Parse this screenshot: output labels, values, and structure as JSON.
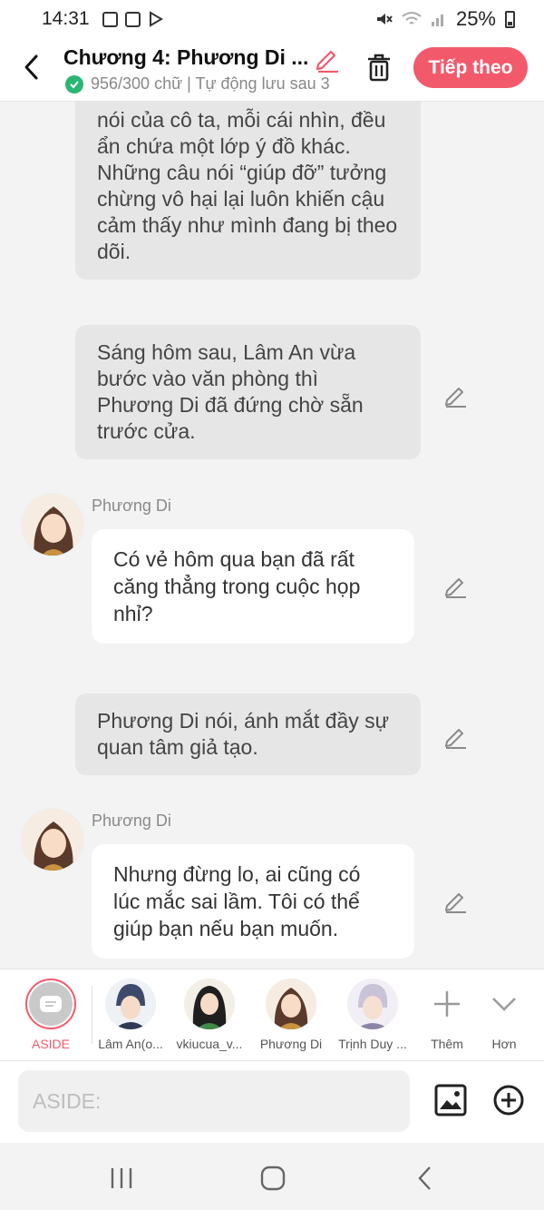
{
  "status_bar": {
    "time": "14:31",
    "battery": "25%"
  },
  "header": {
    "title": "Chương 4: Phương Di ...",
    "subtitle": "956/300 chữ | Tự động lưu sau 3",
    "next_label": "Tiếp theo"
  },
  "messages": [
    {
      "type": "narration",
      "text": "nói của cô ta, mỗi cái nhìn, đều ẩn chứa một lớp ý đồ khác. Những câu nói “giúp đỡ” tưởng chừng vô hại lại luôn khiến cậu cảm thấy như mình đang bị theo dõi."
    },
    {
      "type": "narration",
      "text": "Sáng hôm sau, Lâm An vừa bước vào văn phòng thì Phương Di đã đứng chờ sẵn trước cửa."
    },
    {
      "type": "speech",
      "name": "Phương Di",
      "text": "Có vẻ hôm qua bạn đã rất căng thẳng trong cuộc họp nhỉ?"
    },
    {
      "type": "narration",
      "text": " Phương Di nói, ánh mắt đầy sự quan tâm giả tạo."
    },
    {
      "type": "speech",
      "name": "Phương Di",
      "text": "Nhưng đừng lo, ai cũng có lúc mắc sai lầm. Tôi có thể giúp bạn nếu bạn muốn."
    }
  ],
  "characters": [
    {
      "label": "ASIDE"
    },
    {
      "label": "Lâm An(o..."
    },
    {
      "label": "vkiucua_v..."
    },
    {
      "label": "Phương Di"
    },
    {
      "label": "Trịnh Duy ..."
    }
  ],
  "more_label": "Thêm",
  "collapse_label": "Hơn",
  "input": {
    "placeholder": "ASIDE:"
  },
  "colors": {
    "accent": "#f2596b",
    "check": "#2bb673"
  }
}
